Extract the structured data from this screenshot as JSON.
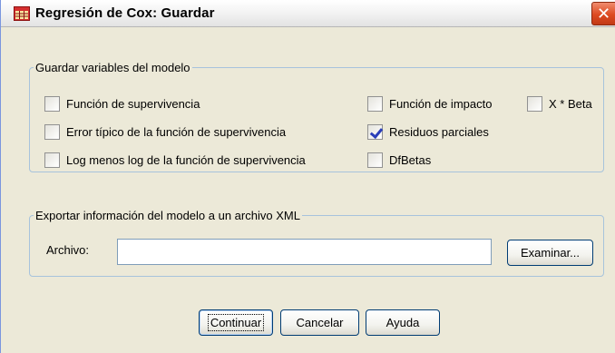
{
  "window": {
    "title": "Regresión de Cox: Guardar",
    "close_glyph": "✕",
    "icon": "spreadsheet-icon"
  },
  "save_group": {
    "legend": "Guardar variables del modelo",
    "options": {
      "funcion_supervivencia": {
        "label": "Función de supervivencia",
        "checked": false
      },
      "error_tipico": {
        "label": "Error típico de la función de supervivencia",
        "checked": false
      },
      "log_menos_log": {
        "label": "Log menos log de la función de supervivencia",
        "checked": false
      },
      "funcion_impacto": {
        "label": "Función de impacto",
        "checked": false
      },
      "x_beta": {
        "label": "X * Beta",
        "checked": false
      },
      "residuos_parciales": {
        "label": "Residuos parciales",
        "checked": true
      },
      "dfbetas": {
        "label": "DfBetas",
        "checked": false
      }
    }
  },
  "export_group": {
    "legend": "Exportar información del modelo a un archivo XML",
    "file_label": "Archivo:",
    "file_value": "",
    "browse_label": "Examinar..."
  },
  "buttons": {
    "continue": "Continuar",
    "cancel": "Cancelar",
    "help": "Ayuda"
  },
  "colors": {
    "dialog_bg": "#ece9d8",
    "group_border": "#a7c3dc",
    "button_border": "#003c74",
    "close_button": "#dd4b22",
    "check_mark": "#2a3eb8"
  }
}
